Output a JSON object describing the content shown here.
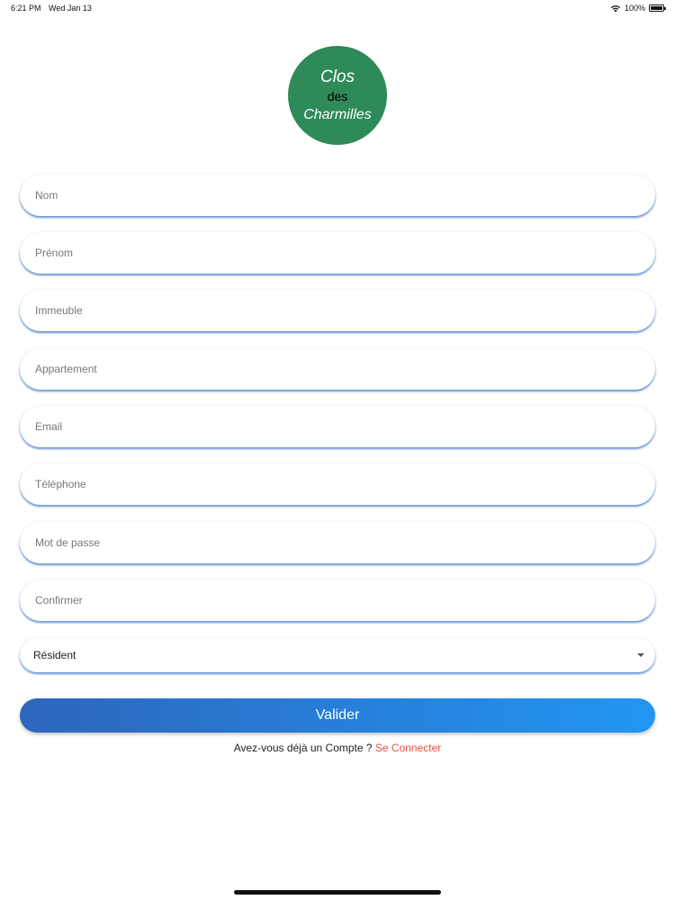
{
  "status_bar": {
    "time": "6:21 PM",
    "date": "Wed Jan 13",
    "battery_percent": "100%",
    "icons": [
      "wifi-icon",
      "battery-icon"
    ]
  },
  "logo": {
    "line1": "Clos",
    "line2": "des",
    "line3": "Charmilles",
    "background_color": "#2f8a59"
  },
  "form": {
    "fields": [
      {
        "placeholder": "Nom",
        "value": ""
      },
      {
        "placeholder": "Prénom",
        "value": ""
      },
      {
        "placeholder": "Immeuble",
        "value": ""
      },
      {
        "placeholder": "Appartement",
        "value": ""
      },
      {
        "placeholder": "Email",
        "value": ""
      },
      {
        "placeholder": "Téléphone",
        "value": ""
      },
      {
        "placeholder": "Mot de passe",
        "value": ""
      },
      {
        "placeholder": "Confirmer",
        "value": ""
      }
    ],
    "role_select": {
      "selected": "Résident",
      "icon": "dropdown-caret-icon"
    },
    "submit_label": "Valider",
    "submit_gradient": [
      "#2d66bd",
      "#2196f3"
    ]
  },
  "footer": {
    "prompt": "Avez-vous déjà un Compte ?",
    "login_link": "Se Connecter",
    "link_color": "#e5533d"
  }
}
